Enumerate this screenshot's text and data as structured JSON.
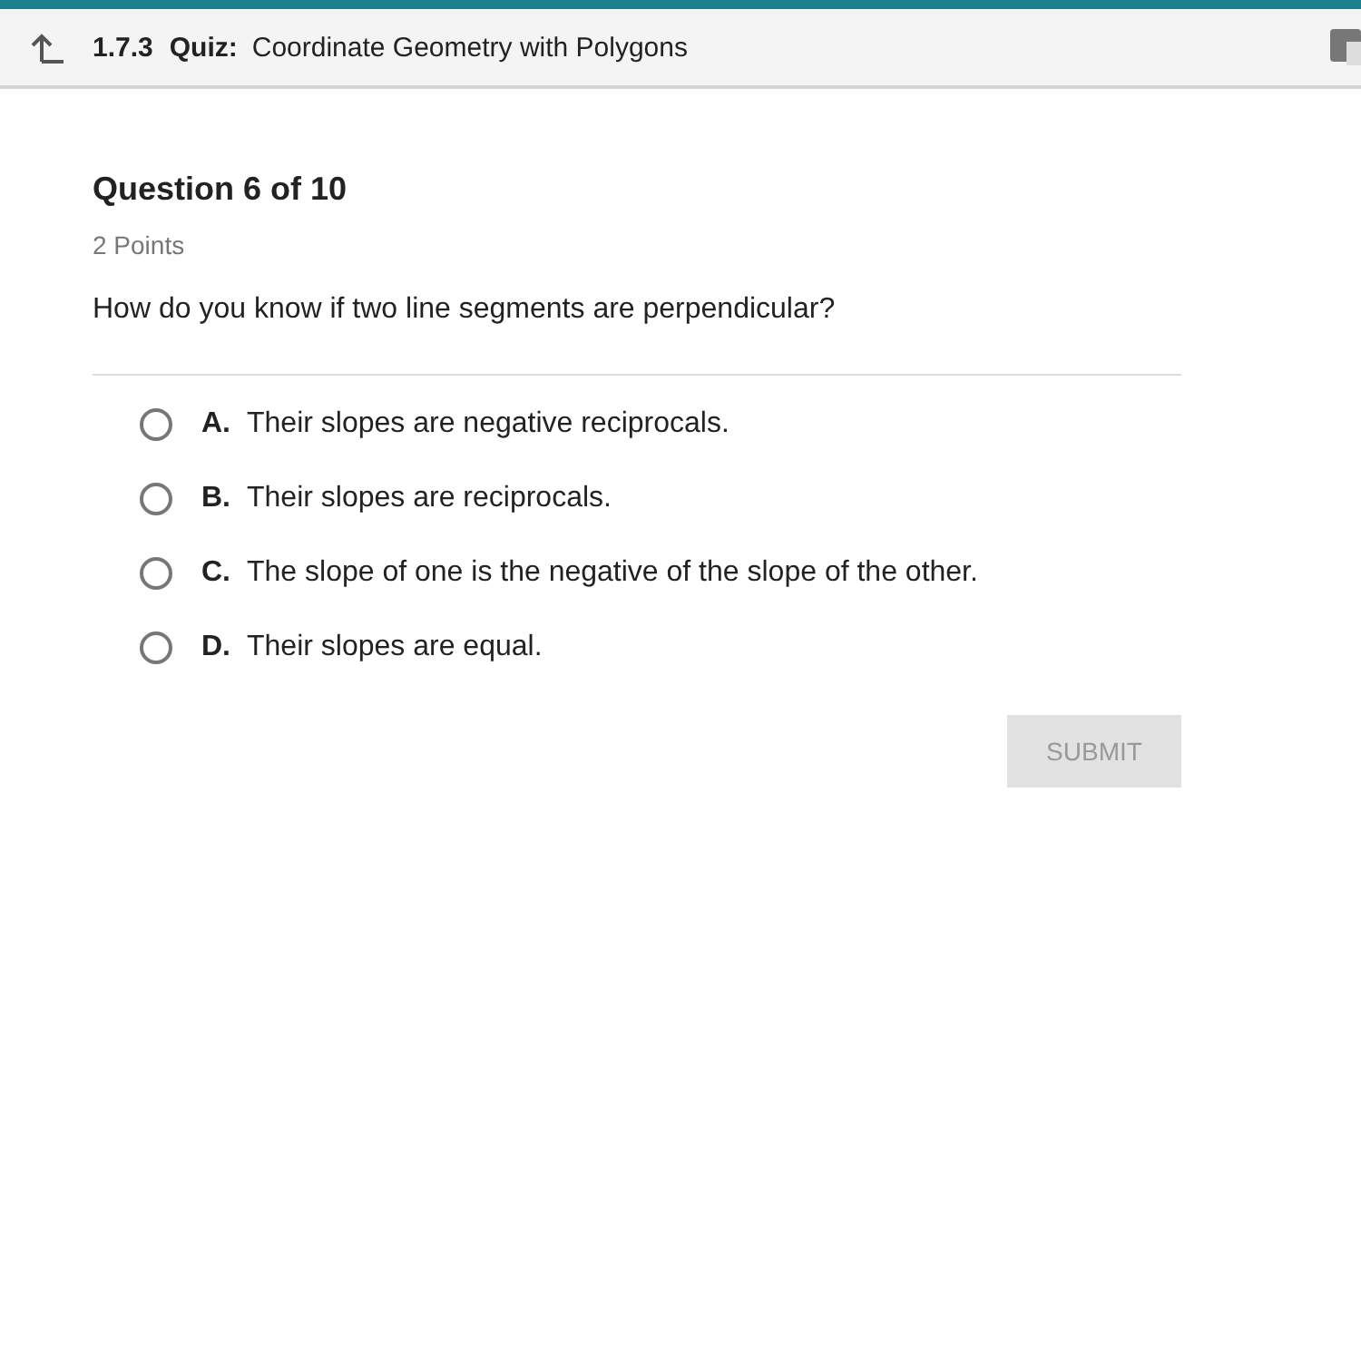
{
  "header": {
    "code": "1.7.3",
    "type": "Quiz:",
    "title": "Coordinate Geometry with Polygons"
  },
  "question": {
    "heading": "Question 6 of 10",
    "points": "2 Points",
    "prompt": "How do you know if two line segments are perpendicular?"
  },
  "options": [
    {
      "letter": "A.",
      "text": "Their slopes are negative reciprocals.",
      "selected": false
    },
    {
      "letter": "B.",
      "text": "Their slopes are reciprocals.",
      "selected": false
    },
    {
      "letter": "C.",
      "text": "The slope of one is the negative of the slope of the other.",
      "selected": false
    },
    {
      "letter": "D.",
      "text": "Their slopes are equal.",
      "selected": false
    }
  ],
  "submit": {
    "label": "SUBMIT",
    "disabled": true
  }
}
